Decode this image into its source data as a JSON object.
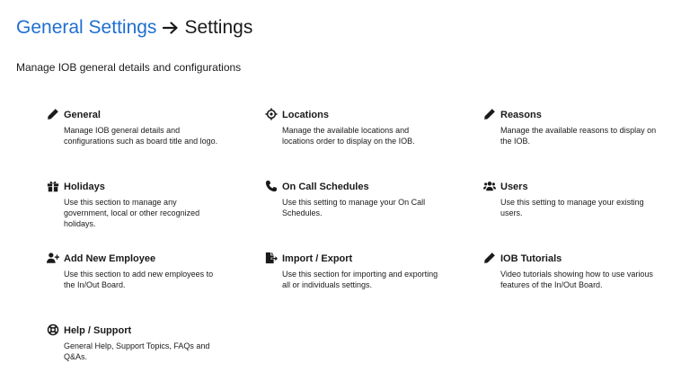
{
  "breadcrumb": {
    "parent": "General Settings",
    "current": "Settings"
  },
  "subtitle": "Manage IOB general details and configurations",
  "cards": [
    {
      "title": "General",
      "icon": "pencil-icon",
      "description": "Manage IOB general details and configurations such as board title and logo."
    },
    {
      "title": "Locations",
      "icon": "crosshairs-icon",
      "description": "Manage the available locations and locations order to display on the IOB."
    },
    {
      "title": "Reasons",
      "icon": "pencil-icon",
      "description": "Manage the available reasons to display on the IOB."
    },
    {
      "title": "Holidays",
      "icon": "gift-icon",
      "description": "Use this section to manage any government, local or other recognized holidays."
    },
    {
      "title": "On Call Schedules",
      "icon": "phone-icon",
      "description": "Use this setting to manage your On Call Schedules."
    },
    {
      "title": "Users",
      "icon": "users-icon",
      "description": "Use this setting to manage your existing users."
    },
    {
      "title": "Add New Employee",
      "icon": "user-plus-icon",
      "description": "Use this section to add new employees to the In/Out Board."
    },
    {
      "title": "Import / Export",
      "icon": "file-export-icon",
      "description": "Use this section for importing and exporting all or individuals settings."
    },
    {
      "title": "IOB Tutorials",
      "icon": "pencil-icon",
      "description": "Video tutorials showing how to use various features of the In/Out Board."
    },
    {
      "title": "Help / Support",
      "icon": "life-ring-icon",
      "description": "General Help, Support Topics, FAQs and Q&As."
    }
  ]
}
